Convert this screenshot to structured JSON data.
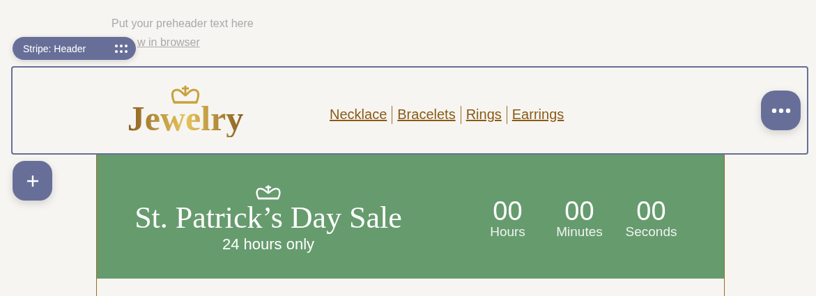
{
  "preheader": {
    "text": "Put your preheader text here",
    "link": "w in browser"
  },
  "stripe_badge": {
    "label": "Stripe: Header"
  },
  "header": {
    "logo": "Jewelry",
    "nav": [
      "Necklace",
      "Bracelets",
      "Rings",
      "Earrings"
    ]
  },
  "banner": {
    "title": "St. Patrick’s Day Sale",
    "subtitle": "24 hours only",
    "countdown": [
      {
        "value": "00",
        "unit": "Hours"
      },
      {
        "value": "00",
        "unit": "Minutes"
      },
      {
        "value": "00",
        "unit": "Seconds"
      }
    ]
  }
}
